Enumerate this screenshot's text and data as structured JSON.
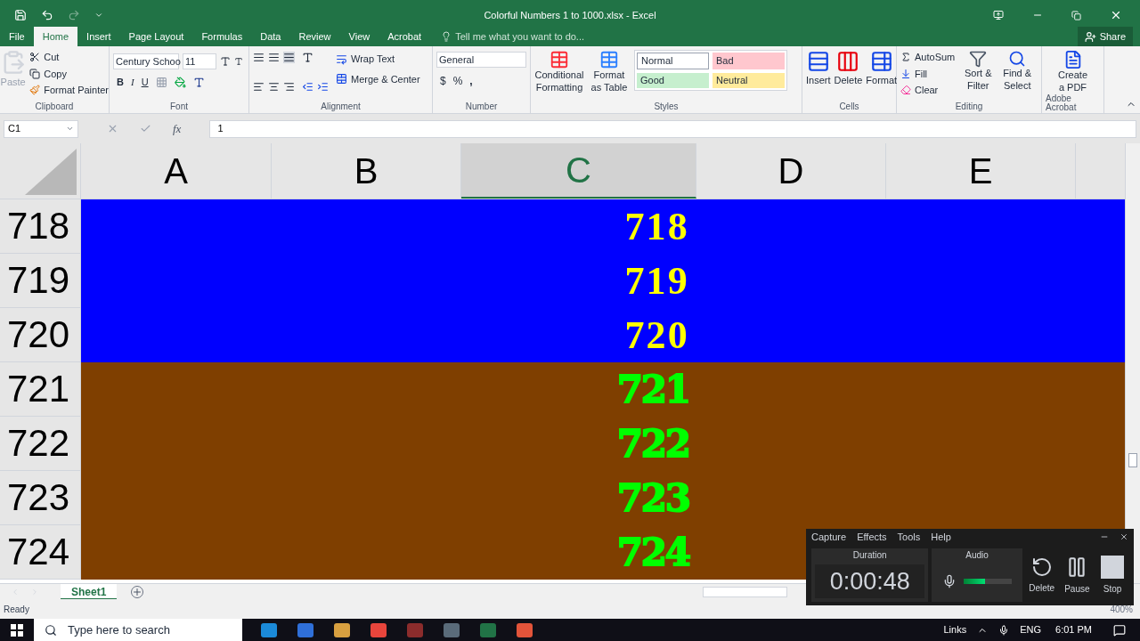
{
  "window": {
    "title": "Colorful Numbers 1 to 1000.xlsx - Excel"
  },
  "tabs": [
    {
      "label": "File",
      "selected": false
    },
    {
      "label": "Home",
      "selected": true
    },
    {
      "label": "Insert",
      "selected": false
    },
    {
      "label": "Page Layout",
      "selected": false
    },
    {
      "label": "Formulas",
      "selected": false
    },
    {
      "label": "Data",
      "selected": false
    },
    {
      "label": "Review",
      "selected": false
    },
    {
      "label": "View",
      "selected": false
    },
    {
      "label": "Acrobat",
      "selected": false
    }
  ],
  "tell_me": {
    "placeholder": "Tell me what you want to do..."
  },
  "share": "Share",
  "clipboard": {
    "paste": "Paste",
    "cut": "Cut",
    "copy": "Copy",
    "format_painter": "Format Painter",
    "label": "Clipboard"
  },
  "font": {
    "name": "Century Schoo",
    "size": "11",
    "bold": "B",
    "italic": "I",
    "underline": "U",
    "label": "Font"
  },
  "alignment": {
    "wrap": "Wrap Text",
    "merge": "Merge & Center",
    "label": "Alignment"
  },
  "number": {
    "format": "General",
    "currency": "$",
    "percent": "%",
    "comma": ",",
    "label": "Number"
  },
  "styles": {
    "conditional": "Conditional Formatting",
    "format_table": "Format as Table",
    "gallery": [
      {
        "label": "Normal",
        "color": "#ffffff"
      },
      {
        "label": "Bad",
        "color": "#ffc7ce"
      },
      {
        "label": "Good",
        "color": "#c6efce"
      },
      {
        "label": "Neutral",
        "color": "#ffeb9c"
      }
    ],
    "label": "Styles"
  },
  "cells": {
    "buttons": [
      "Insert",
      "Delete",
      "Format"
    ],
    "label": "Cells"
  },
  "editing": {
    "autosum": "AutoSum",
    "fill": "Fill",
    "clear": "Clear",
    "sort": "Sort & Filter",
    "find": "Find & Select",
    "label": "Editing"
  },
  "acrobat": {
    "create": "Create a PDF",
    "label": "Adobe Acrobat"
  },
  "formula_bar": {
    "name_box": "C1",
    "fx": "fx",
    "value": "1"
  },
  "columns": [
    {
      "label": "A",
      "selected": false
    },
    {
      "label": "B",
      "selected": false
    },
    {
      "label": "C",
      "selected": true
    },
    {
      "label": "D",
      "selected": false
    },
    {
      "label": "E",
      "selected": false
    }
  ],
  "rows": [
    {
      "number": "718",
      "value": "718",
      "color": "#0000ff",
      "kind": "serif"
    },
    {
      "number": "719",
      "value": "719",
      "color": "#0000ff",
      "kind": "serif"
    },
    {
      "number": "720",
      "value": "720",
      "color": "#0000ff",
      "kind": "serif"
    },
    {
      "number": "721",
      "value": "721",
      "color": "#7f3f00",
      "kind": "heavy"
    },
    {
      "number": "722",
      "value": "722",
      "color": "#7f3f00",
      "kind": "heavy"
    },
    {
      "number": "723",
      "value": "723",
      "color": "#7f3f00",
      "kind": "heavy"
    },
    {
      "number": "724",
      "value": "724",
      "color": "#7f3f00",
      "kind": "heavy"
    }
  ],
  "sheet_tabs": [
    {
      "label": "Sheet1",
      "selected": true
    }
  ],
  "status_bar": {
    "text": "Ready",
    "zoom": "400%"
  },
  "recorder": {
    "menu": [
      "Capture",
      "Effects",
      "Tools",
      "Help"
    ],
    "duration_label": "Duration",
    "duration": "0:00:48",
    "audio_label": "Audio",
    "level": 0.45,
    "buttons": [
      "Delete",
      "Pause",
      "Stop"
    ]
  },
  "taskbar": {
    "search": {
      "placeholder": "Type here to search"
    },
    "links": "Links",
    "language": "ENG",
    "time": "6:01 PM"
  }
}
